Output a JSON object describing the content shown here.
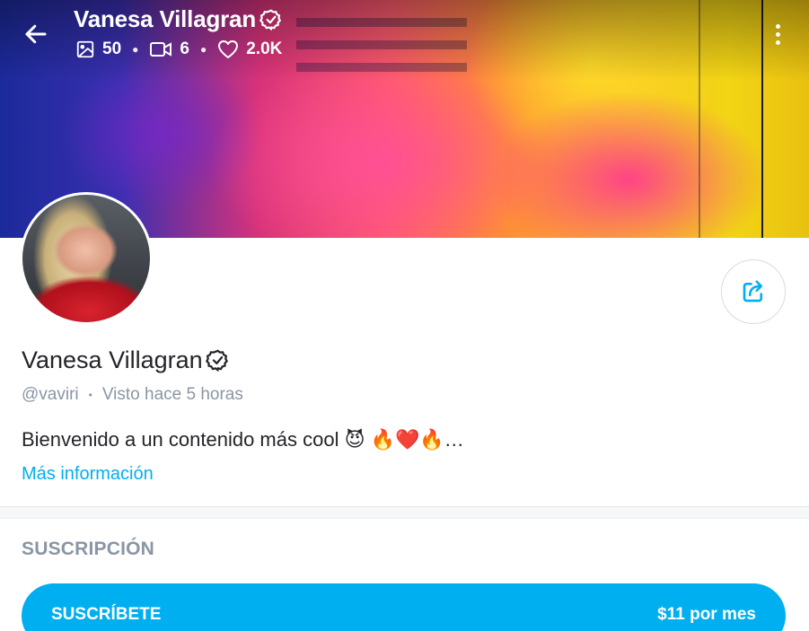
{
  "header": {
    "name": "Vanesa Villagran",
    "stats": {
      "photos": "50",
      "videos": "6",
      "likes": "2.0K"
    }
  },
  "profile": {
    "name": "Vanesa Villagran",
    "handle": "@vaviri",
    "last_seen": "Visto hace 5 horas",
    "bio": "Bienvenido a un contenido más cool 😈 🔥❤️🔥…",
    "more_info": "Más información"
  },
  "subscription": {
    "title": "SUSCRIPCIÓN",
    "button_label": "SUSCRÍBETE",
    "price": "$11 por mes"
  },
  "icons": {
    "back": "arrow-left-icon",
    "verified": "verified-badge-icon",
    "photos": "image-icon",
    "videos": "video-icon",
    "likes": "heart-icon",
    "more": "more-vertical-icon",
    "share": "share-icon"
  },
  "colors": {
    "accent": "#00aff0",
    "muted_text": "#8a96a3",
    "text": "#242529"
  }
}
